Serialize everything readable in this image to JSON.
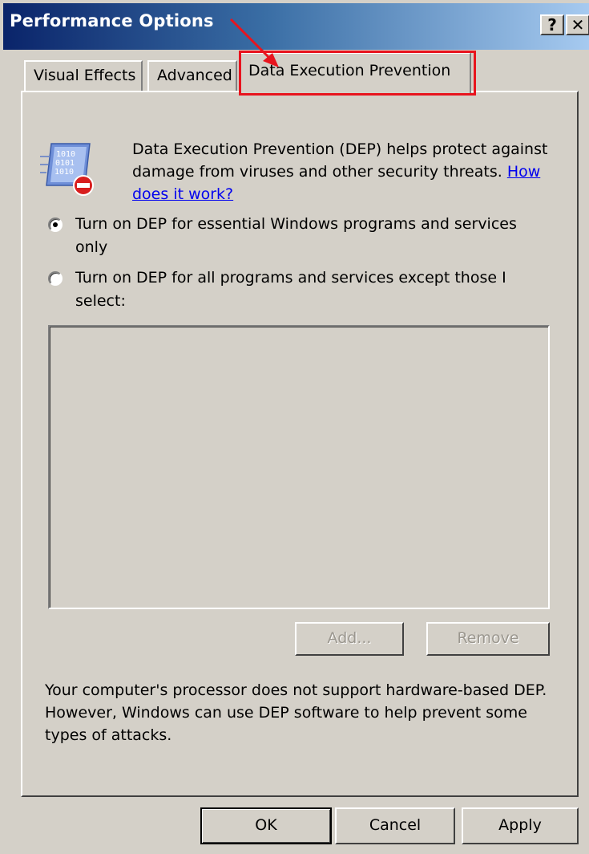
{
  "window": {
    "title": "Performance Options",
    "help_glyph": "?",
    "close_glyph": "✕"
  },
  "tabs": [
    {
      "label": "Visual Effects",
      "selected": false
    },
    {
      "label": "Advanced",
      "selected": false
    },
    {
      "label": "Data Execution Prevention",
      "selected": true
    }
  ],
  "dep_panel": {
    "icon": "dep-shield-binary-icon",
    "description": "Data Execution Prevention (DEP) helps protect against damage from viruses and other security threats.",
    "help_link": "How does it work?",
    "options": [
      {
        "label": "Turn on DEP for essential Windows programs and services only",
        "checked": true
      },
      {
        "label": "Turn on DEP for all programs and services except those I select:",
        "checked": false
      }
    ],
    "add_button": "Add...",
    "remove_button": "Remove",
    "note": "Your computer's processor does not support hardware-based DEP. However, Windows can use DEP software to help prevent some types of attacks."
  },
  "footer": {
    "ok": "OK",
    "cancel": "Cancel",
    "apply": "Apply"
  },
  "annotation": {
    "highlight_color": "#e8141e"
  }
}
